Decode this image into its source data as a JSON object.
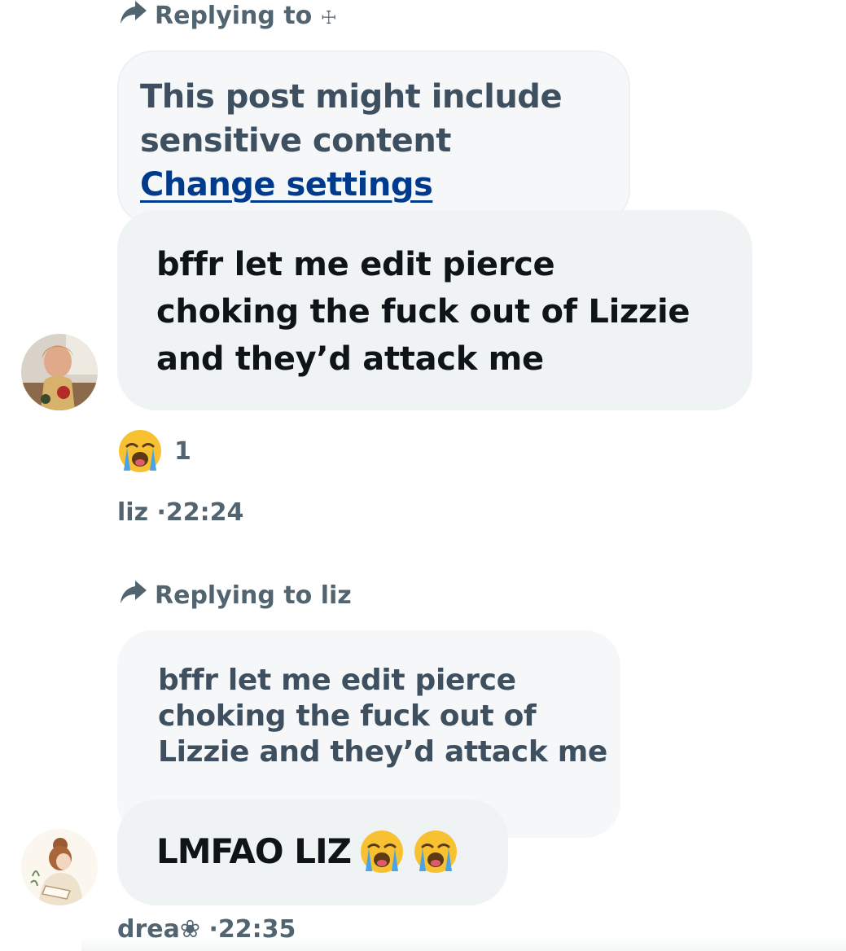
{
  "thread": [
    {
      "reply_to_label": "Replying to ",
      "reply_to_name": "☩",
      "quoted_text_line1": "This post might include",
      "quoted_text_line2": "sensitive content",
      "quoted_link": "Change settings",
      "message_line1": "bffr let me edit pierce",
      "message_line2": "choking the fuck out of Lizzie",
      "message_line3": "and they’d attack me",
      "reaction_emoji": "loudly-crying-face",
      "reaction_count": "1",
      "author": "liz",
      "time": "22:24"
    },
    {
      "reply_to_label": "Replying to ",
      "reply_to_name": "liz",
      "quoted_text_line1": "bffr let me edit pierce",
      "quoted_text_line2": "choking the fuck out of",
      "quoted_text_line3": "Lizzie and they’d attack me",
      "message_text": "LMFAO LIZ",
      "message_emojis": [
        "loudly-crying-face",
        "loudly-crying-face"
      ],
      "author": "drea❀",
      "time": "22:35"
    }
  ],
  "colors": {
    "bubble": "#eff3f4",
    "quote_bubble": "#f5f7f8",
    "secondary_text": "#536471",
    "link": "#003a8c",
    "emoji_face": "#f7c131"
  }
}
